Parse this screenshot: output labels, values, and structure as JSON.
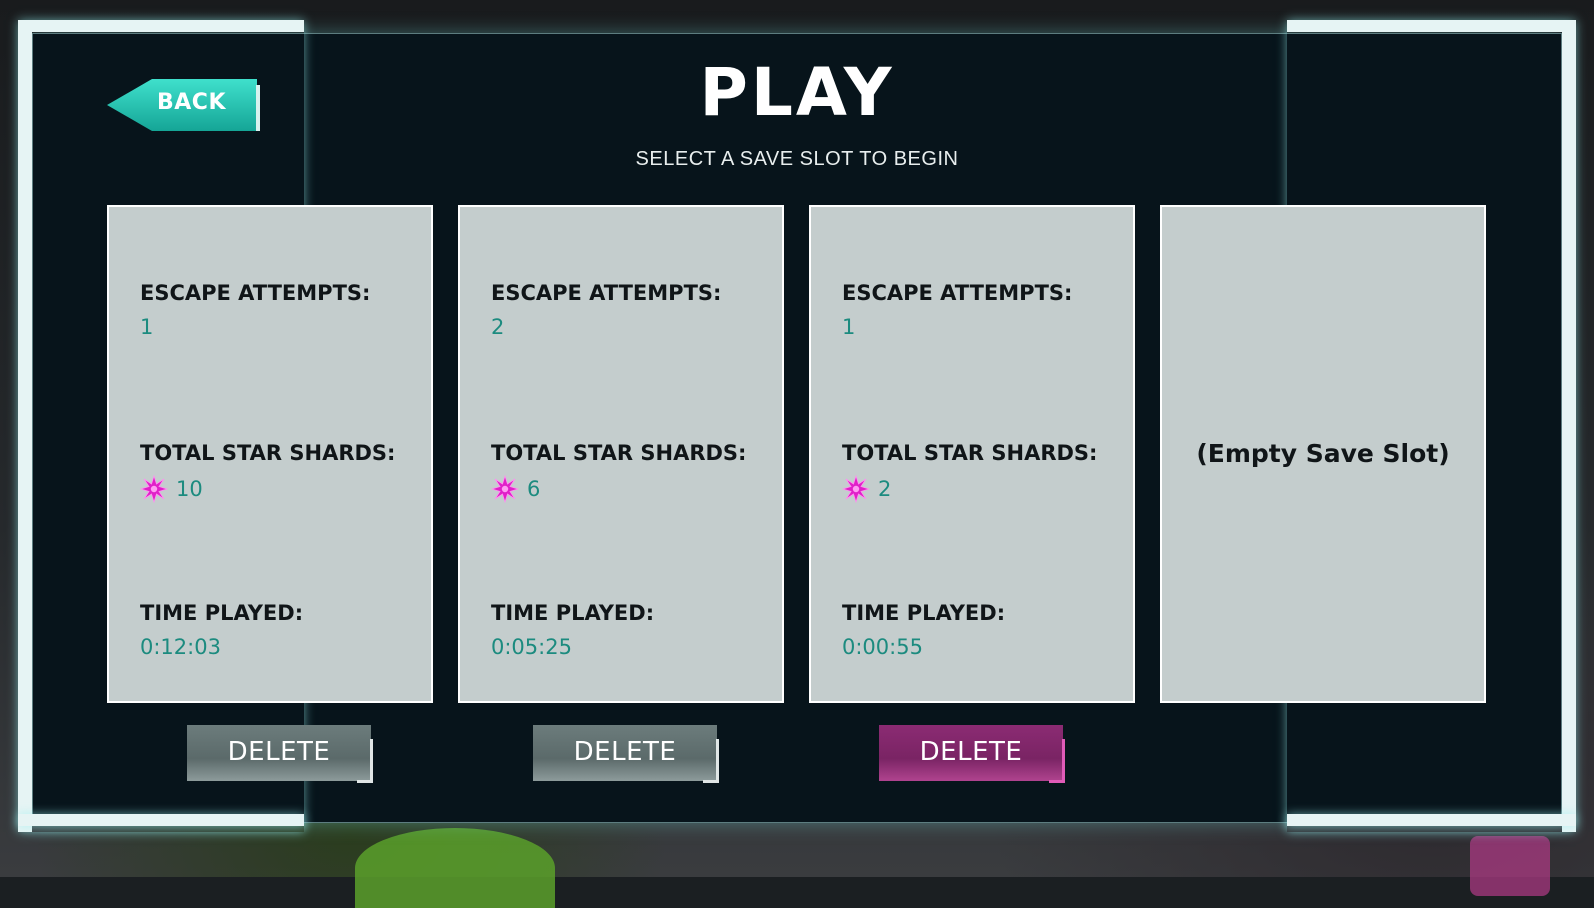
{
  "header": {
    "back_label": "BACK",
    "title": "PLAY",
    "subtitle": "SELECT A SAVE SLOT TO BEGIN"
  },
  "labels": {
    "escape_attempts": "ESCAPE ATTEMPTS:",
    "total_star_shards": "TOTAL STAR SHARDS:",
    "time_played": "TIME PLAYED:",
    "delete": "DELETE"
  },
  "slots": [
    {
      "escape_attempts": "1",
      "star_shards": "10",
      "time_played": "0:12:03"
    },
    {
      "escape_attempts": "2",
      "star_shards": "6",
      "time_played": "0:05:25"
    },
    {
      "escape_attempts": "1",
      "star_shards": "2",
      "time_played": "0:00:55"
    },
    {
      "empty_label": "(Empty Save Slot)"
    }
  ],
  "colors": {
    "panel_bg": "#07141b",
    "slot_bg": "#c4cdcd",
    "value_teal": "#1c8b7f",
    "back_accent": "#2bc4b2",
    "delete_grey": "#647474",
    "delete_pink": "#82286b",
    "star_magenta": "#e020c8"
  },
  "icons": {
    "star_shard": "star-shard-icon",
    "back_arrow": "arrow-left-shape"
  }
}
